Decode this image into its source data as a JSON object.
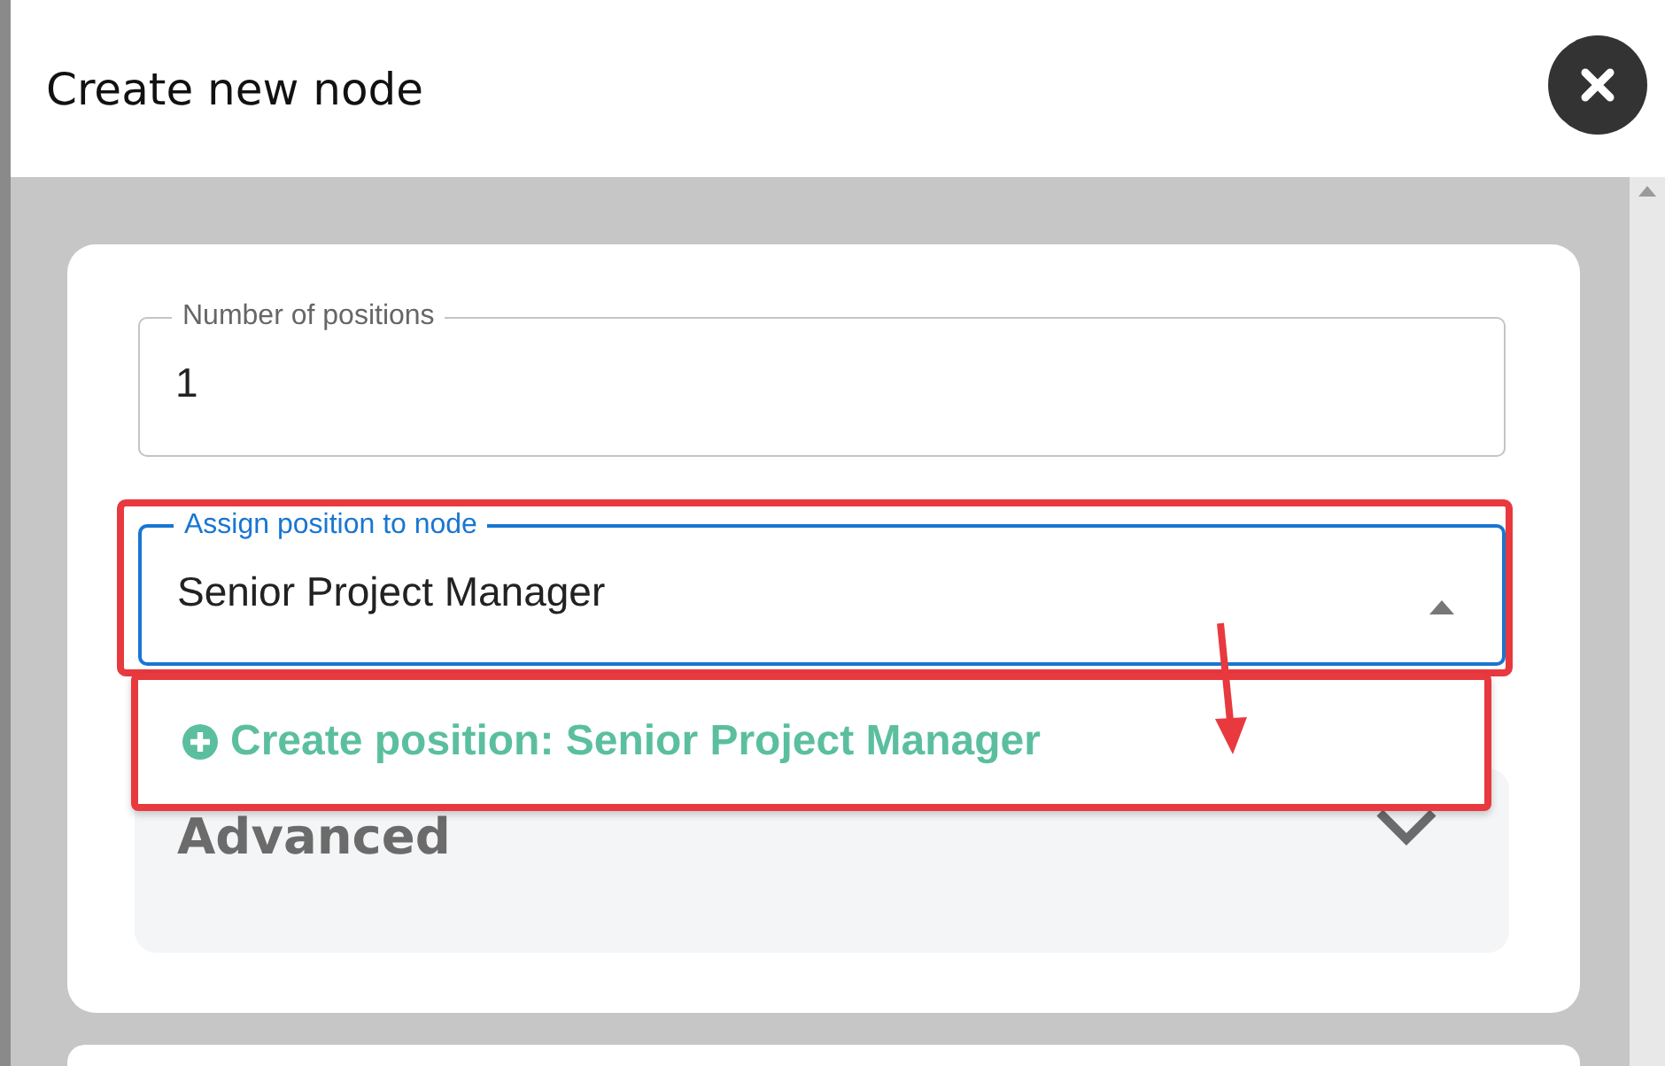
{
  "dialog": {
    "title": "Create new node"
  },
  "fields": [
    {
      "label": "Number of positions",
      "value": "1",
      "focused": false,
      "highlighted": false
    },
    {
      "label": "Assign position to node",
      "value": "Senior Project Manager",
      "focused": true,
      "expanded": true,
      "highlighted": true
    }
  ],
  "dropdown": {
    "highlighted": true,
    "options": [
      {
        "label": "Create position: Senior Project Manager"
      }
    ]
  },
  "advanced": {
    "label": "Advanced",
    "expanded": false
  }
}
